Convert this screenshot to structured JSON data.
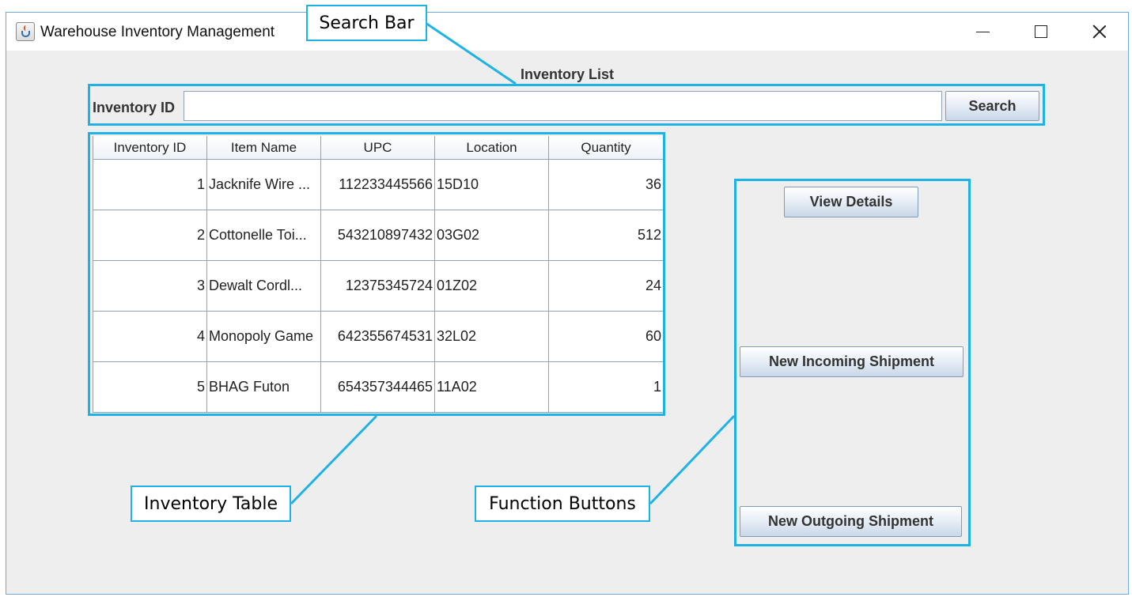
{
  "window": {
    "title": "Warehouse Inventory Management"
  },
  "main": {
    "heading": "Inventory List",
    "search": {
      "label": "Inventory ID",
      "value": "",
      "button_label": "Search"
    },
    "table": {
      "columns": [
        "Inventory ID",
        "Item Name",
        "UPC",
        "Location",
        "Quantity"
      ],
      "rows": [
        {
          "id": "1",
          "name": "Jacknife Wire ...",
          "upc": "112233445566",
          "location": "15D10",
          "quantity": "36"
        },
        {
          "id": "2",
          "name": "Cottonelle Toi...",
          "upc": "543210897432",
          "location": "03G02",
          "quantity": "512"
        },
        {
          "id": "3",
          "name": "Dewalt Cordl...",
          "upc": "12375345724",
          "location": "01Z02",
          "quantity": "24"
        },
        {
          "id": "4",
          "name": "Monopoly Game",
          "upc": "642355674531",
          "location": "32L02",
          "quantity": "60"
        },
        {
          "id": "5",
          "name": "BHAG Futon",
          "upc": "654357344465",
          "location": "11A02",
          "quantity": "1"
        }
      ]
    },
    "buttons": {
      "view_details": "View Details",
      "new_incoming": "New Incoming Shipment",
      "new_outgoing": "New Outgoing Shipment"
    }
  },
  "annotations": {
    "search_bar": "Search Bar",
    "inventory_table": "Inventory Table",
    "function_buttons": "Function Buttons"
  },
  "colors": {
    "callout": "#1fb2e6",
    "panel_background": "#eeeeee"
  }
}
